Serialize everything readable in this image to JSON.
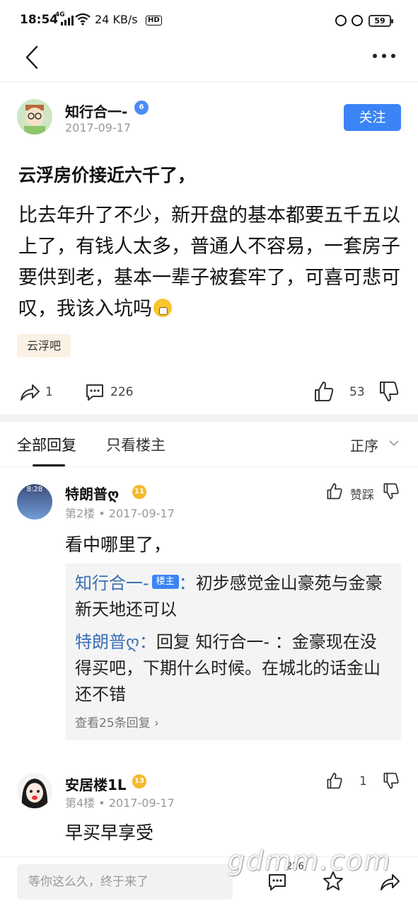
{
  "status_bar": {
    "time": "18:54",
    "network": "4G",
    "speed": "24 KB/s",
    "hd_label": "HD",
    "battery": "59"
  },
  "nav": {
    "back_icon": "chevron-left-icon",
    "more_icon": "more-horizontal-icon"
  },
  "author": {
    "name": "知行合一-",
    "level": "6",
    "date": "2017-09-17",
    "follow_label": "关注"
  },
  "post": {
    "title": "云浮房价接近六千了，",
    "body": "比去年升了不少，新开盘的基本都要五千五以上了，有钱人太多，普通人不容易，一套房子要供到老，基本一辈子被套牢了，可喜可悲可叹，我该入坑吗",
    "forum_tag": "云浮吧"
  },
  "actions": {
    "share_count": "1",
    "comment_count": "226",
    "like_count": "53"
  },
  "tabs": {
    "all_replies": "全部回复",
    "host_only": "只看楼主",
    "sort_label": "正序"
  },
  "replies": [
    {
      "name": "特朗普ღ",
      "level": "11",
      "floor": "第2楼",
      "date": "2017-09-17",
      "avatar_time": "8:28",
      "text": "看中哪里了，",
      "vote_label": "赞踩",
      "sub_replies": [
        {
          "name": "知行合一-",
          "tag": "楼主",
          "text": "初步感觉金山豪苑与金豪新天地还可以"
        },
        {
          "name": "特朗普ღ",
          "text": "回复 知行合一- ：金豪现在没得买吧，下期什么时候。在城北的话金山还不错"
        }
      ],
      "more_label": "查看25条回复"
    },
    {
      "name": "安居楼1L",
      "level": "13",
      "floor": "第4楼",
      "date": "2017-09-17",
      "text": "早买早享受",
      "like_count": "1"
    }
  ],
  "bottom_bar": {
    "input_placeholder": "等你这么久，终于来了",
    "comment_count": "226"
  },
  "watermark": "gdmm.com",
  "colors": {
    "accent": "#3a84f5",
    "quote_name": "#3a6fb5",
    "tag_bg": "#faf1e4",
    "badge_gold": "#f3b92d"
  }
}
